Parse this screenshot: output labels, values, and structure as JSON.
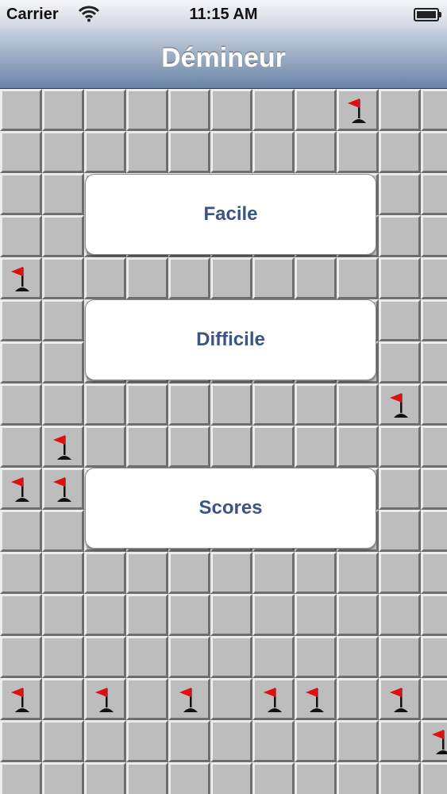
{
  "status_bar": {
    "carrier": "Carrier",
    "time": "11:15 AM"
  },
  "nav_bar": {
    "title": "Démineur"
  },
  "menu": {
    "facile_label": "Facile",
    "difficile_label": "Difficile",
    "scores_label": "Scores"
  },
  "board": {
    "columns": 11,
    "rows": 17,
    "flagged_cells": [
      [
        0,
        8
      ],
      [
        4,
        0
      ],
      [
        7,
        9
      ],
      [
        8,
        1
      ],
      [
        9,
        0
      ],
      [
        9,
        1
      ],
      [
        14,
        0
      ],
      [
        14,
        2
      ],
      [
        14,
        4
      ],
      [
        14,
        6
      ],
      [
        14,
        7
      ],
      [
        14,
        9
      ],
      [
        15,
        10
      ]
    ]
  },
  "colors": {
    "nav_accent": "#6a84a8",
    "button_text": "#3a5585",
    "tile": "#bdbdbd",
    "flag": "#e01010"
  },
  "icons": {
    "status_wifi": "wifi-icon",
    "status_battery": "battery-icon",
    "tile_flag": "flag-icon"
  }
}
